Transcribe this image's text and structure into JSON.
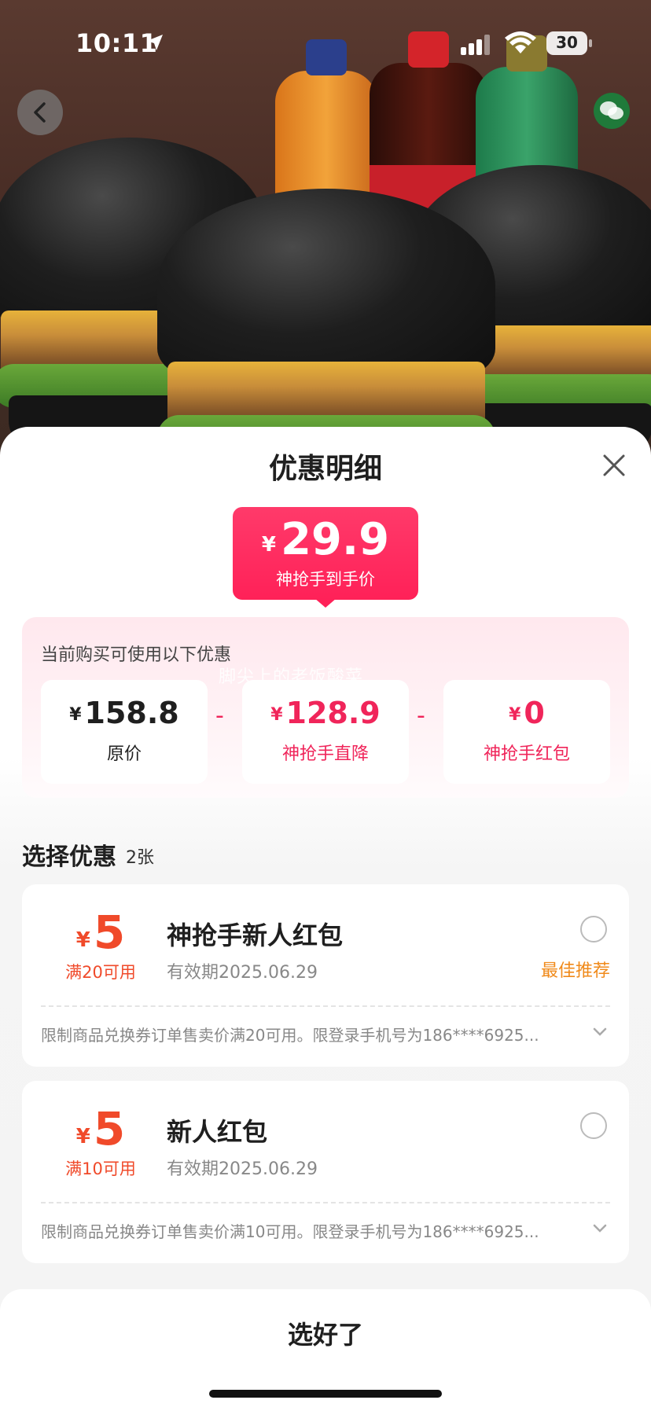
{
  "status_bar": {
    "time": "10:11",
    "battery": "30"
  },
  "sheet": {
    "title": "优惠明细"
  },
  "price_badge": {
    "currency": "¥",
    "amount": "29.9",
    "caption": "神抢手到手价"
  },
  "discounts": {
    "intro": "当前购买可使用以下优惠",
    "watermark": "脚尖上的老饭酸菜",
    "items": [
      {
        "currency": "¥",
        "value": "158.8",
        "label": "原价"
      },
      {
        "currency": "¥",
        "value": "128.9",
        "label": "神抢手直降"
      },
      {
        "currency": "¥",
        "value": "0",
        "label": "神抢手红包"
      }
    ],
    "operator": "-"
  },
  "coupons": {
    "title": "选择优惠",
    "count": "2张",
    "items": [
      {
        "currency": "¥",
        "amount": "5",
        "condition": "满20可用",
        "name": "神抢手新人红包",
        "validity": "有效期2025.06.29",
        "recommend": "最佳推荐",
        "description": "限制商品兑换券订单售卖价满20可用。限登录手机号为186****6925..."
      },
      {
        "currency": "¥",
        "amount": "5",
        "condition": "满10可用",
        "name": "新人红包",
        "validity": "有效期2025.06.29",
        "description": "限制商品兑换券订单售卖价满10可用。限登录手机号为186****6925..."
      }
    ]
  },
  "footer": {
    "confirm_label": "选好了"
  },
  "colors": {
    "accent": "#f0255a",
    "coupon_red": "#f04a2a",
    "recommend_orange": "#f08a1a"
  }
}
